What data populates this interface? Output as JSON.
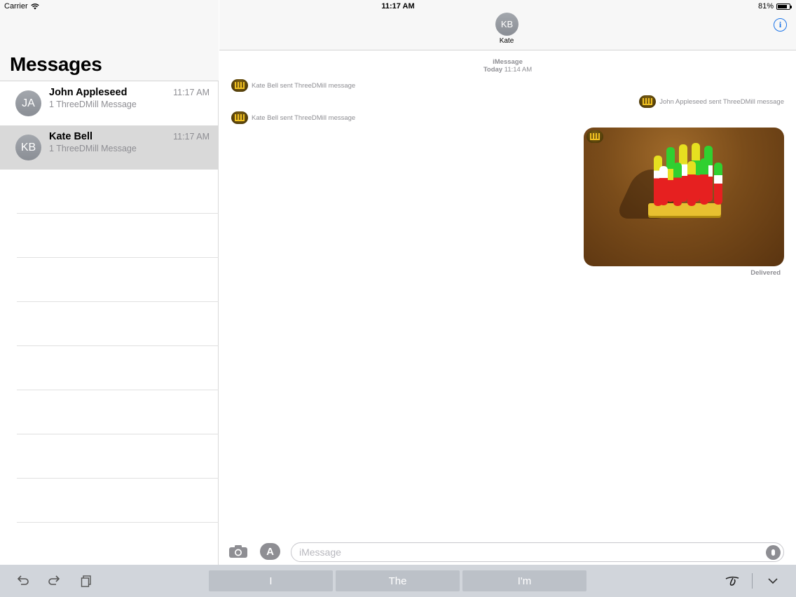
{
  "status_bar": {
    "carrier": "Carrier",
    "time": "11:17 AM",
    "battery": "81%",
    "battery_level": 0.81
  },
  "sidebar": {
    "title": "Messages",
    "conversations": [
      {
        "initials": "JA",
        "name": "John Appleseed",
        "preview": "1 ThreeDMill Message",
        "time": "11:17 AM",
        "selected": false
      },
      {
        "initials": "KB",
        "name": "Kate Bell",
        "preview": "1 ThreeDMill Message",
        "time": "11:17 AM",
        "selected": true
      }
    ]
  },
  "chat": {
    "contact_initials": "KB",
    "contact_name": "Kate",
    "service": "iMessage",
    "date_label": "Today",
    "date_time": "11:14 AM",
    "messages": [
      {
        "text": "Kate Bell sent ThreeDMill message",
        "side": "left"
      },
      {
        "text": "John Appleseed sent ThreeDMill message",
        "side": "right"
      },
      {
        "text": "Kate Bell sent ThreeDMill message",
        "side": "left"
      }
    ],
    "delivery_status": "Delivered"
  },
  "input": {
    "placeholder": "iMessage"
  },
  "keyboard": {
    "suggestions": [
      "I",
      "The",
      "I'm"
    ],
    "icons": [
      "undo-icon",
      "redo-icon",
      "paste-icon",
      "handwriting-icon",
      "dismiss-keyboard-icon"
    ]
  },
  "colors": {
    "accent": "#1a73e8",
    "selected_row": "#d9d9d9",
    "secondary_text": "#8e8e93"
  }
}
